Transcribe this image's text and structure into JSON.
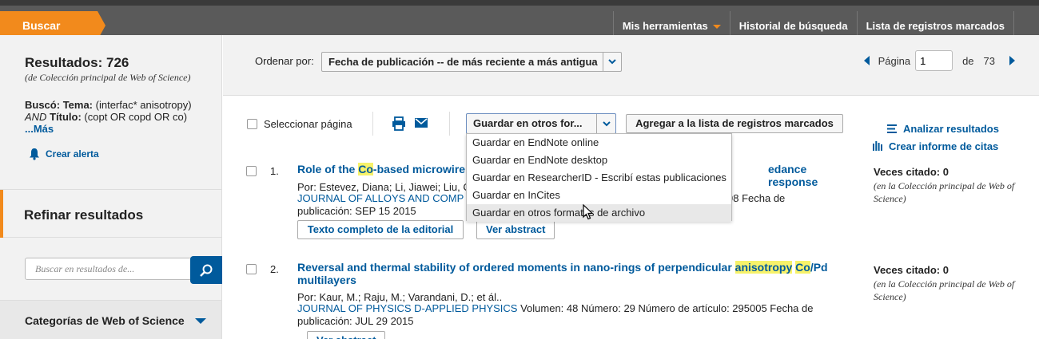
{
  "topbar": {
    "search_tab": "Buscar",
    "nav": [
      "Mis herramientas",
      "Historial de búsqueda",
      "Lista de registros marcados"
    ]
  },
  "sidebar": {
    "results_title": "Resultados: 726",
    "results_subtitle": "(de Colección principal de Web of Science)",
    "query_prefix": "Buscó:",
    "query_topic_label": "Tema:",
    "query_topic_value": "(interfac* anisotropy)",
    "query_and": "AND",
    "query_title_label": "Título:",
    "query_title_value": "(copt OR copd OR co)",
    "more_link": "...Más",
    "create_alert": "Crear alerta",
    "refine_heading": "Refinar resultados",
    "search_placeholder": "Buscar en resultados de...",
    "categories_heading": "Categorías de Web of Science"
  },
  "sortbar": {
    "sort_label": "Ordenar por:",
    "sort_value": "Fecha de publicación -- de más reciente a más antigua",
    "page_label": "Página",
    "page_value": "1",
    "of_label": "de",
    "total_pages": "73"
  },
  "toolbar": {
    "select_page": "Seleccionar página",
    "save_select_value": "Guardar en otros for...",
    "add_marked_button": "Agregar a la lista de registros marcados",
    "analyze_link": "Analizar resultados",
    "citation_report_link": "Crear informe de citas"
  },
  "save_options": [
    "Guardar en EndNote online",
    "Guardar en EndNote desktop",
    "Guardar en ResearcherID - Escribí estas publicaciones",
    "Guardar en InCites",
    "Guardar en otros formatos de archivo"
  ],
  "records": [
    {
      "number": "1.",
      "title_a": "Role of the ",
      "title_hl1": "Co",
      "title_b": "-based microwire",
      "title_end": "edance response",
      "authors": "Por: Estevez, Diana; Li, Jiawei; Liu, C",
      "journal": "JOURNAL OF ALLOYS AND COMP",
      "source_tail": "98   Fecha de",
      "pubdate": "publicación: SEP 15 2015",
      "btn_fulltext": "Texto completo de la editorial",
      "btn_abstract": "Ver abstract",
      "cited_label": "Veces citado: 0",
      "cited_sub": "(en la Colección principal de Web of Science)"
    },
    {
      "number": "2.",
      "title_a": "Reversal and thermal stability of ordered moments in nano-rings of perpendicular ",
      "title_hl1": "anisotropy",
      "title_mid": " ",
      "title_hl2": "Co",
      "title_b": "/Pd multilayers",
      "authors": "Por: Kaur, M.; Raju, M.; Varandani, D.; et ál..",
      "journal": "JOURNAL OF PHYSICS D-APPLIED PHYSICS",
      "source_tail": "  Volumen: 48   Número: 29     Número de artículo: 295005   Fecha de",
      "pubdate": "publicación: JUL 29 2015",
      "btn_abstract": "Ver abstract",
      "cited_label": "Veces citado: 0",
      "cited_sub": "(en la Colección principal de Web of Science)"
    }
  ],
  "colors": {
    "accent_orange": "#f28a1c",
    "link_blue": "#005a9c",
    "topbar_gray": "#5a5a5a",
    "highlight_yellow": "#f7f26a"
  }
}
